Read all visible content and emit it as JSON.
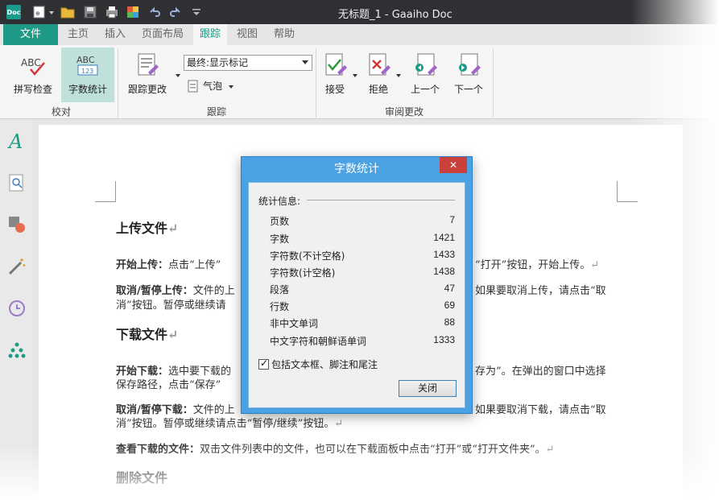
{
  "window": {
    "title": "无标题_1 - Gaaiho Doc",
    "logo_text": "Doc"
  },
  "menu": {
    "file": "文件",
    "tabs": [
      "主页",
      "插入",
      "页面布局",
      "跟踪",
      "视图",
      "帮助"
    ]
  },
  "ribbon": {
    "proofing": {
      "spellcheck": "拼写检查",
      "wordcount": "字数统计",
      "group": "校对"
    },
    "tracking": {
      "track_changes": "跟踪更改",
      "display_option": "最终:显示标记",
      "balloons": "气泡",
      "group": "跟踪"
    },
    "review": {
      "accept": "接受",
      "reject": "拒绝",
      "previous": "上一个",
      "next": "下一个",
      "group": "审阅更改"
    }
  },
  "document": {
    "h1": "上传文件",
    "p1_bold": "开始上传：",
    "p1_a": "点击“上传”",
    "p1_b": "“打开”按钮，开始上传。",
    "p2_bold": "取消/暂停上传：",
    "p2_a": "文件的上",
    "p2_b": "如果要取消上传，请点击“取",
    "p2_line2": "消”按钮。暂停或继续请",
    "h2": "下载文件",
    "p3_bold": "开始下载：",
    "p3_a": "选中要下载的",
    "p3_b": "存为”。在弹出的窗口中选择",
    "p3_line2": "保存路径，点击“保存”",
    "p4_bold": "取消/暂停下载：",
    "p4_a": "文件的上",
    "p4_b": "如果要取消下载，请点击“取",
    "p4_line2": "消”按钮。暂停或继续请点击“暂停/继续”按钮。",
    "p5_bold": "查看下载的文件：",
    "p5_text": "双击文件列表中的文件，也可以在下载面板中点击“打开”或“打开文件夹”。",
    "h3": "删除文件"
  },
  "dialog": {
    "title": "字数统计",
    "close_icon": "✕",
    "section": "统计信息:",
    "stats": [
      {
        "label": "页数",
        "value": "7"
      },
      {
        "label": "字数",
        "value": "1421"
      },
      {
        "label": "字符数(不计空格)",
        "value": "1433"
      },
      {
        "label": "字符数(计空格)",
        "value": "1438"
      },
      {
        "label": "段落",
        "value": "47"
      },
      {
        "label": "行数",
        "value": "69"
      },
      {
        "label": "非中文单词",
        "value": "88"
      },
      {
        "label": "中文字符和朝鲜语单词",
        "value": "1333"
      }
    ],
    "include_label": "包括文本框、脚注和尾注",
    "close_button": "关闭"
  },
  "colors": {
    "accent": "#1e9a86",
    "dialog_frame": "#4ba2e2",
    "close_red": "#c9413a"
  }
}
